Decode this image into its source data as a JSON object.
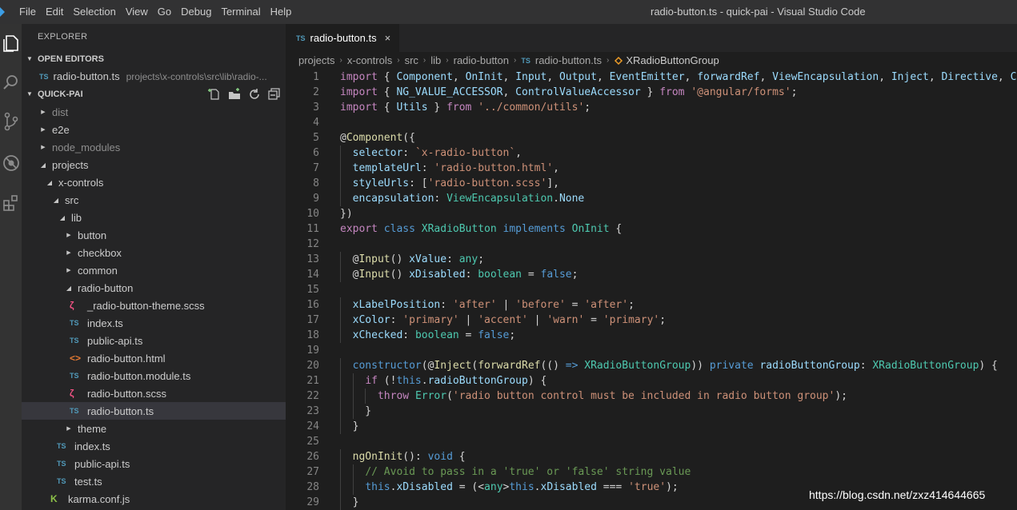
{
  "titlebar": {
    "menus": [
      "File",
      "Edit",
      "Selection",
      "View",
      "Go",
      "Debug",
      "Terminal",
      "Help"
    ],
    "window_title": "radio-button.ts - quick-pai - Visual Studio Code"
  },
  "sidebar": {
    "title": "EXPLORER",
    "open_editors": {
      "header": "OPEN EDITORS",
      "items": [
        {
          "icon": "TS",
          "name": "radio-button.ts",
          "path": "projects\\x-controls\\src\\lib\\radio-..."
        }
      ]
    },
    "project": {
      "header": "QUICK-PAI",
      "tree": [
        {
          "name": "dist",
          "type": "folder",
          "open": false,
          "depth": 0,
          "dim": true
        },
        {
          "name": "e2e",
          "type": "folder",
          "open": false,
          "depth": 0
        },
        {
          "name": "node_modules",
          "type": "folder",
          "open": false,
          "depth": 0,
          "dim": true
        },
        {
          "name": "projects",
          "type": "folder",
          "open": true,
          "depth": 0
        },
        {
          "name": "x-controls",
          "type": "folder",
          "open": true,
          "depth": 1
        },
        {
          "name": "src",
          "type": "folder",
          "open": true,
          "depth": 2
        },
        {
          "name": "lib",
          "type": "folder",
          "open": true,
          "depth": 3
        },
        {
          "name": "button",
          "type": "folder",
          "open": false,
          "depth": 4
        },
        {
          "name": "checkbox",
          "type": "folder",
          "open": false,
          "depth": 4
        },
        {
          "name": "common",
          "type": "folder",
          "open": false,
          "depth": 4
        },
        {
          "name": "radio-button",
          "type": "folder",
          "open": true,
          "depth": 4
        },
        {
          "name": "_radio-button-theme.scss",
          "type": "scss",
          "depth": 5
        },
        {
          "name": "index.ts",
          "type": "ts",
          "depth": 5
        },
        {
          "name": "public-api.ts",
          "type": "ts",
          "depth": 5
        },
        {
          "name": "radio-button.html",
          "type": "html",
          "depth": 5
        },
        {
          "name": "radio-button.module.ts",
          "type": "ts",
          "depth": 5
        },
        {
          "name": "radio-button.scss",
          "type": "scss",
          "depth": 5
        },
        {
          "name": "radio-button.ts",
          "type": "ts",
          "depth": 5,
          "selected": true
        },
        {
          "name": "theme",
          "type": "folder",
          "open": false,
          "depth": 4
        },
        {
          "name": "index.ts",
          "type": "ts",
          "depth": 3
        },
        {
          "name": "public-api.ts",
          "type": "ts",
          "depth": 3
        },
        {
          "name": "test.ts",
          "type": "ts",
          "depth": 3
        },
        {
          "name": "karma.conf.js",
          "type": "karma",
          "depth": 2
        }
      ]
    }
  },
  "editor": {
    "tab": {
      "icon": "TS",
      "label": "radio-button.ts",
      "close": "×"
    },
    "breadcrumbs": [
      "projects",
      "x-controls",
      "src",
      "lib",
      "radio-button",
      "radio-button.ts",
      "XRadioButtonGroup"
    ],
    "breadcrumb_file_icon": "TS",
    "lines": [
      [
        [
          "import",
          "c"
        ],
        [
          " { ",
          "p"
        ],
        [
          "Component",
          "v"
        ],
        [
          ", ",
          "p"
        ],
        [
          "OnInit",
          "v"
        ],
        [
          ", ",
          "p"
        ],
        [
          "Input",
          "v"
        ],
        [
          ", ",
          "p"
        ],
        [
          "Output",
          "v"
        ],
        [
          ", ",
          "p"
        ],
        [
          "EventEmitter",
          "v"
        ],
        [
          ", ",
          "p"
        ],
        [
          "forwardRef",
          "v"
        ],
        [
          ", ",
          "p"
        ],
        [
          "ViewEncapsulation",
          "v"
        ],
        [
          ", ",
          "p"
        ],
        [
          "Inject",
          "v"
        ],
        [
          ", ",
          "p"
        ],
        [
          "Directive",
          "v"
        ],
        [
          ", ",
          "p"
        ],
        [
          "Con",
          "v"
        ]
      ],
      [
        [
          "import",
          "c"
        ],
        [
          " { ",
          "p"
        ],
        [
          "NG_VALUE_ACCESSOR",
          "v"
        ],
        [
          ", ",
          "p"
        ],
        [
          "ControlValueAccessor",
          "v"
        ],
        [
          " } ",
          "p"
        ],
        [
          "from",
          "c"
        ],
        [
          " ",
          "p"
        ],
        [
          "'@angular/forms'",
          "s"
        ],
        [
          ";",
          "p"
        ]
      ],
      [
        [
          "import",
          "c"
        ],
        [
          " { ",
          "p"
        ],
        [
          "Utils",
          "v"
        ],
        [
          " } ",
          "p"
        ],
        [
          "from",
          "c"
        ],
        [
          " ",
          "p"
        ],
        [
          "'../common/utils'",
          "s"
        ],
        [
          ";",
          "p"
        ]
      ],
      [],
      [
        [
          "@",
          "p"
        ],
        [
          "Component",
          "f"
        ],
        [
          "({",
          "p"
        ]
      ],
      [
        [
          "  ",
          "p"
        ],
        [
          "selector",
          "v"
        ],
        [
          ": ",
          "p"
        ],
        [
          "`x-radio-button`",
          "s"
        ],
        [
          ",",
          "p"
        ]
      ],
      [
        [
          "  ",
          "p"
        ],
        [
          "templateUrl",
          "v"
        ],
        [
          ": ",
          "p"
        ],
        [
          "'radio-button.html'",
          "s"
        ],
        [
          ",",
          "p"
        ]
      ],
      [
        [
          "  ",
          "p"
        ],
        [
          "styleUrls",
          "v"
        ],
        [
          ": [",
          "p"
        ],
        [
          "'radio-button.scss'",
          "s"
        ],
        [
          "],",
          "p"
        ]
      ],
      [
        [
          "  ",
          "p"
        ],
        [
          "encapsulation",
          "v"
        ],
        [
          ": ",
          "p"
        ],
        [
          "ViewEncapsulation",
          "t"
        ],
        [
          ".",
          "p"
        ],
        [
          "None",
          "v"
        ]
      ],
      [
        [
          "})",
          "p"
        ]
      ],
      [
        [
          "export",
          "c"
        ],
        [
          " ",
          "p"
        ],
        [
          "class",
          "k"
        ],
        [
          " ",
          "p"
        ],
        [
          "XRadioButton",
          "t"
        ],
        [
          " ",
          "p"
        ],
        [
          "implements",
          "k"
        ],
        [
          " ",
          "p"
        ],
        [
          "OnInit",
          "t"
        ],
        [
          " {",
          "p"
        ]
      ],
      [],
      [
        [
          "  @",
          "p"
        ],
        [
          "Input",
          "f"
        ],
        [
          "() ",
          "p"
        ],
        [
          "xValue",
          "v"
        ],
        [
          ": ",
          "p"
        ],
        [
          "any",
          "t"
        ],
        [
          ";",
          "p"
        ]
      ],
      [
        [
          "  @",
          "p"
        ],
        [
          "Input",
          "f"
        ],
        [
          "() ",
          "p"
        ],
        [
          "xDisabled",
          "v"
        ],
        [
          ": ",
          "p"
        ],
        [
          "boolean",
          "t"
        ],
        [
          " = ",
          "p"
        ],
        [
          "false",
          "k"
        ],
        [
          ";",
          "p"
        ]
      ],
      [],
      [
        [
          "  ",
          "p"
        ],
        [
          "xLabelPosition",
          "v"
        ],
        [
          ": ",
          "p"
        ],
        [
          "'after'",
          "s"
        ],
        [
          " | ",
          "p"
        ],
        [
          "'before'",
          "s"
        ],
        [
          " = ",
          "p"
        ],
        [
          "'after'",
          "s"
        ],
        [
          ";",
          "p"
        ]
      ],
      [
        [
          "  ",
          "p"
        ],
        [
          "xColor",
          "v"
        ],
        [
          ": ",
          "p"
        ],
        [
          "'primary'",
          "s"
        ],
        [
          " | ",
          "p"
        ],
        [
          "'accent'",
          "s"
        ],
        [
          " | ",
          "p"
        ],
        [
          "'warn'",
          "s"
        ],
        [
          " = ",
          "p"
        ],
        [
          "'primary'",
          "s"
        ],
        [
          ";",
          "p"
        ]
      ],
      [
        [
          "  ",
          "p"
        ],
        [
          "xChecked",
          "v"
        ],
        [
          ": ",
          "p"
        ],
        [
          "boolean",
          "t"
        ],
        [
          " = ",
          "p"
        ],
        [
          "false",
          "k"
        ],
        [
          ";",
          "p"
        ]
      ],
      [],
      [
        [
          "  ",
          "p"
        ],
        [
          "constructor",
          "k"
        ],
        [
          "(@",
          "p"
        ],
        [
          "Inject",
          "f"
        ],
        [
          "(",
          "p"
        ],
        [
          "forwardRef",
          "f"
        ],
        [
          "(() ",
          "p"
        ],
        [
          "=>",
          "k"
        ],
        [
          " ",
          "p"
        ],
        [
          "XRadioButtonGroup",
          "t"
        ],
        [
          ")) ",
          "p"
        ],
        [
          "private",
          "k"
        ],
        [
          " ",
          "p"
        ],
        [
          "radioButtonGroup",
          "v"
        ],
        [
          ": ",
          "p"
        ],
        [
          "XRadioButtonGroup",
          "t"
        ],
        [
          ") {",
          "p"
        ]
      ],
      [
        [
          "    ",
          "p"
        ],
        [
          "if",
          "c"
        ],
        [
          " (!",
          "p"
        ],
        [
          "this",
          "k"
        ],
        [
          ".",
          "p"
        ],
        [
          "radioButtonGroup",
          "v"
        ],
        [
          ") {",
          "p"
        ]
      ],
      [
        [
          "      ",
          "p"
        ],
        [
          "throw",
          "c"
        ],
        [
          " ",
          "p"
        ],
        [
          "Error",
          "t"
        ],
        [
          "(",
          "p"
        ],
        [
          "'radio button control must be included in radio button group'",
          "s"
        ],
        [
          ");",
          "p"
        ]
      ],
      [
        [
          "    }",
          "p"
        ]
      ],
      [
        [
          "  }",
          "p"
        ]
      ],
      [],
      [
        [
          "  ",
          "p"
        ],
        [
          "ngOnInit",
          "f"
        ],
        [
          "(): ",
          "p"
        ],
        [
          "void",
          "k"
        ],
        [
          " {",
          "p"
        ]
      ],
      [
        [
          "    ",
          "p"
        ],
        [
          "// Avoid to pass in a 'true' or 'false' string value",
          "cm"
        ]
      ],
      [
        [
          "    ",
          "p"
        ],
        [
          "this",
          "k"
        ],
        [
          ".",
          "p"
        ],
        [
          "xDisabled",
          "v"
        ],
        [
          " = (<",
          "p"
        ],
        [
          "any",
          "t"
        ],
        [
          ">",
          "p"
        ],
        [
          "this",
          "k"
        ],
        [
          ".",
          "p"
        ],
        [
          "xDisabled",
          "v"
        ],
        [
          " === ",
          "p"
        ],
        [
          "'true'",
          "s"
        ],
        [
          ");",
          "p"
        ]
      ],
      [
        [
          "  }",
          "p"
        ]
      ]
    ]
  },
  "watermark": "https://blog.csdn.net/zxz414644665"
}
